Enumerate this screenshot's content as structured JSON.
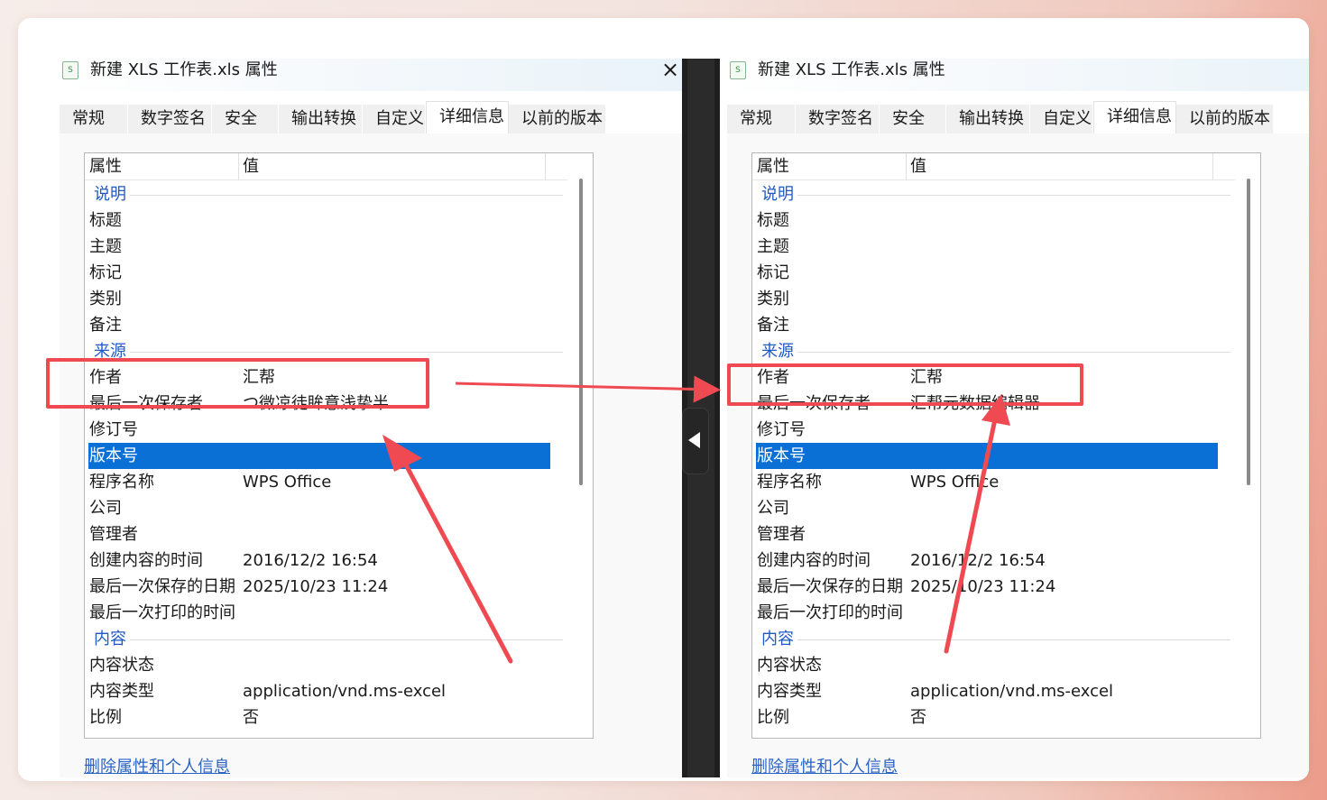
{
  "panes": [
    {
      "title": "新建 XLS 工作表.xls 属性",
      "icon_name": "spreadsheet-file-icon",
      "close_label": "×",
      "tabs": [
        "常规",
        "数字签名",
        "安全",
        "输出转换",
        "自定义",
        "详细信息",
        "以前的版本"
      ],
      "active_tab": "详细信息",
      "columns": [
        "属性",
        "值"
      ],
      "rows": [
        {
          "kind": "group",
          "name": "说明",
          "value": ""
        },
        {
          "kind": "item",
          "name": "标题",
          "value": ""
        },
        {
          "kind": "item",
          "name": "主题",
          "value": ""
        },
        {
          "kind": "item",
          "name": "标记",
          "value": ""
        },
        {
          "kind": "item",
          "name": "类别",
          "value": ""
        },
        {
          "kind": "item",
          "name": "备注",
          "value": ""
        },
        {
          "kind": "group",
          "name": "来源",
          "value": ""
        },
        {
          "kind": "item",
          "name": "作者",
          "value": "汇帮"
        },
        {
          "kind": "item",
          "name": "最后一次保存者",
          "value": "つ微凉徒眸意浅挚半"
        },
        {
          "kind": "item",
          "name": "修订号",
          "value": ""
        },
        {
          "kind": "selected",
          "name": "版本号",
          "value": ""
        },
        {
          "kind": "item",
          "name": "程序名称",
          "value": "WPS Office"
        },
        {
          "kind": "item",
          "name": "公司",
          "value": ""
        },
        {
          "kind": "item",
          "name": "管理者",
          "value": ""
        },
        {
          "kind": "item",
          "name": "创建内容的时间",
          "value": "2016/12/2 16:54"
        },
        {
          "kind": "item",
          "name": "最后一次保存的日期",
          "value": "2025/10/23 11:24"
        },
        {
          "kind": "item",
          "name": "最后一次打印的时间",
          "value": ""
        },
        {
          "kind": "group",
          "name": "内容",
          "value": ""
        },
        {
          "kind": "item",
          "name": "内容状态",
          "value": ""
        },
        {
          "kind": "item",
          "name": "内容类型",
          "value": "application/vnd.ms-excel"
        },
        {
          "kind": "item",
          "name": "比例",
          "value": "否"
        }
      ],
      "link": "删除属性和个人信息"
    },
    {
      "title": "新建 XLS 工作表.xls 属性",
      "icon_name": "spreadsheet-file-icon",
      "close_label": "",
      "tabs": [
        "常规",
        "数字签名",
        "安全",
        "输出转换",
        "自定义",
        "详细信息",
        "以前的版本"
      ],
      "active_tab": "详细信息",
      "columns": [
        "属性",
        "值"
      ],
      "rows": [
        {
          "kind": "group",
          "name": "说明",
          "value": ""
        },
        {
          "kind": "item",
          "name": "标题",
          "value": ""
        },
        {
          "kind": "item",
          "name": "主题",
          "value": ""
        },
        {
          "kind": "item",
          "name": "标记",
          "value": ""
        },
        {
          "kind": "item",
          "name": "类别",
          "value": ""
        },
        {
          "kind": "item",
          "name": "备注",
          "value": ""
        },
        {
          "kind": "group",
          "name": "来源",
          "value": ""
        },
        {
          "kind": "item",
          "name": "作者",
          "value": "汇帮"
        },
        {
          "kind": "item",
          "name": "最后一次保存者",
          "value": "汇帮元数据编辑器"
        },
        {
          "kind": "item",
          "name": "修订号",
          "value": ""
        },
        {
          "kind": "selected",
          "name": "版本号",
          "value": ""
        },
        {
          "kind": "item",
          "name": "程序名称",
          "value": "WPS Office"
        },
        {
          "kind": "item",
          "name": "公司",
          "value": ""
        },
        {
          "kind": "item",
          "name": "管理者",
          "value": ""
        },
        {
          "kind": "item",
          "name": "创建内容的时间",
          "value": "2016/12/2 16:54"
        },
        {
          "kind": "item",
          "name": "最后一次保存的日期",
          "value": "2025/10/23 11:24"
        },
        {
          "kind": "item",
          "name": "最后一次打印的时间",
          "value": ""
        },
        {
          "kind": "group",
          "name": "内容",
          "value": ""
        },
        {
          "kind": "item",
          "name": "内容状态",
          "value": ""
        },
        {
          "kind": "item",
          "name": "内容类型",
          "value": "application/vnd.ms-excel"
        },
        {
          "kind": "item",
          "name": "比例",
          "value": "否"
        }
      ],
      "link": "删除属性和个人信息"
    }
  ],
  "colors": {
    "highlight": "#ef4a52",
    "selection": "#0a70d6",
    "group_text": "#1f59c4",
    "link": "#2a63c4"
  },
  "divider": {
    "handle_icon": "collapse-left-arrow-icon"
  }
}
